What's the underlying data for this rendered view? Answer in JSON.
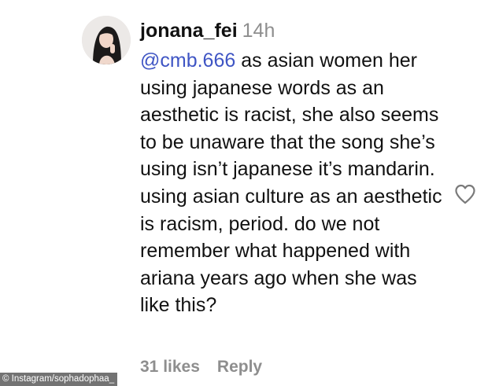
{
  "comment": {
    "username": "jonana_fei",
    "time": "14h",
    "mention": "@cmb.666",
    "text": "as asian women her using japanese words as an aesthetic is racist, she also seems to be unaware that the song she’s using isn’t japanese it’s mandarin. using asian culture as an aesthetic is racism, period. do we not remember what happened with ariana years ago when she was like this?",
    "likes": "31 likes",
    "reply_label": "Reply"
  },
  "credit": "© Instagram/sophadophaa_",
  "icons": {
    "like": "heart-outline-icon",
    "avatar": "profile-photo"
  },
  "colors": {
    "mention": "#3f55c4",
    "muted": "#8e8e8e",
    "text": "#111111"
  }
}
